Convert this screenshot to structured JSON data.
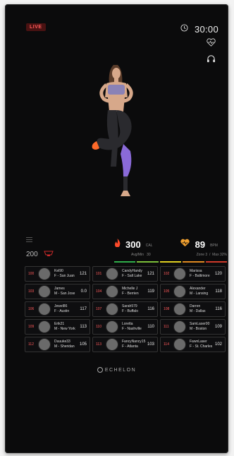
{
  "header": {
    "live_label": "LIVE",
    "timer": "30:00"
  },
  "icons": {
    "clock": "clock-icon",
    "heart_rate": "heartbeat-icon",
    "audio": "headphones-icon"
  },
  "stats": {
    "rank": "200",
    "calories": {
      "value": "300",
      "unit": "CAL",
      "sub_label": "Avg/Min",
      "sub_value": "30"
    },
    "heart_rate": {
      "value": "89",
      "unit": "BPM",
      "zone_label": "Zone",
      "zone_value": "3",
      "max_label": "Max",
      "max_value": "32%"
    }
  },
  "leaderboard": [
    {
      "rank": "100",
      "name": "Kel90",
      "location": "F - San Juan",
      "score": "121"
    },
    {
      "rank": "101",
      "name": "CandyHandy",
      "location": "F - Salt Lake",
      "score": "121"
    },
    {
      "rank": "102",
      "name": "Marissa",
      "location": "F - Baltimore",
      "score": "120"
    },
    {
      "rank": "103",
      "name": "James",
      "location": "M - San Jose",
      "score": "0.0"
    },
    {
      "rank": "104",
      "name": "Michelle J",
      "location": "F - Berrien",
      "score": "119"
    },
    {
      "rank": "105",
      "name": "Alexander",
      "location": "M - Lansing",
      "score": "118"
    },
    {
      "rank": "106",
      "name": "Jewel86",
      "location": "F - Austin",
      "score": "117"
    },
    {
      "rank": "107",
      "name": "Sarah579",
      "location": "F - Buffalo",
      "score": "116"
    },
    {
      "rank": "108",
      "name": "Darren",
      "location": "M - Dallas",
      "score": "116"
    },
    {
      "rank": "109",
      "name": "Erik21",
      "location": "M - New York",
      "score": "113"
    },
    {
      "rank": "110",
      "name": "Loretta",
      "location": "F - Nashville",
      "score": "110"
    },
    {
      "rank": "111",
      "name": "SamLaser00",
      "location": "M - Boston",
      "score": "109"
    },
    {
      "rank": "112",
      "name": "Duuuke33",
      "location": "M - Sheridan",
      "score": "105"
    },
    {
      "rank": "113",
      "name": "FancyNancy15",
      "location": "F - Atlanta",
      "score": "103"
    },
    {
      "rank": "114",
      "name": "FawnLaser",
      "location": "F - St. Charles",
      "score": "102"
    }
  ],
  "brand": "ECHELON",
  "colors": {
    "live_bg": "#4a1212",
    "live_text": "#ff5a5a",
    "calorie_icon": "#ff4a2a",
    "heart_icon": "#f0a030",
    "rank_icon": "#cc2a2a"
  },
  "zone_colors": [
    "#2fae4a",
    "#7cc03a",
    "#e0d020",
    "#e08a20",
    "#d03a2a"
  ]
}
